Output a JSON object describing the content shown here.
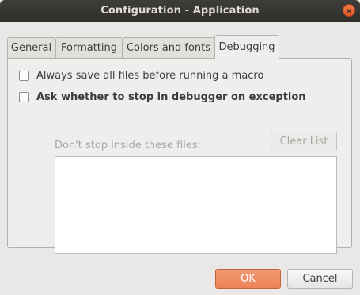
{
  "window": {
    "title": "Configuration - Application",
    "close_glyph": "×"
  },
  "tabs": [
    {
      "label": "General",
      "active": false
    },
    {
      "label": "Formatting",
      "active": false
    },
    {
      "label": "Colors and fonts",
      "active": false
    },
    {
      "label": "Debugging",
      "active": true
    }
  ],
  "debugging": {
    "always_save": {
      "label": "Always save all files before running a macro",
      "checked": false
    },
    "ask_stop": {
      "label": "Ask whether to stop in debugger on exception",
      "checked": false
    },
    "dont_stop_label": "Don't stop inside these files:",
    "clear_list_label": "Clear List",
    "files": []
  },
  "buttons": {
    "ok": "OK",
    "cancel": "Cancel"
  },
  "colors": {
    "accent": "#ec8356",
    "titlebar": "#2f2e2b",
    "background": "#e9e8e6"
  }
}
